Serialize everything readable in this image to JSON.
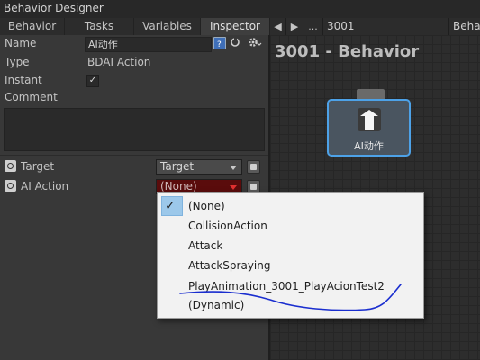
{
  "window": {
    "title": "Behavior Designer"
  },
  "tabs": [
    {
      "label": "Behavior"
    },
    {
      "label": "Tasks"
    },
    {
      "label": "Variables"
    },
    {
      "label": "Inspector"
    }
  ],
  "graph_toolbar": {
    "prev_glyph": "◀",
    "next_glyph": "▶",
    "more_glyph": "...",
    "behavior_id": "3001",
    "behavior_label": "Beha"
  },
  "inspector": {
    "name_label": "Name",
    "name_value": "AI动作",
    "type_label": "Type",
    "type_value": "BDAI Action",
    "instant_label": "Instant",
    "instant_checked": "✓",
    "comment_label": "Comment",
    "comment_value": "",
    "fields": [
      {
        "label": "Target",
        "value": "Target"
      },
      {
        "label": "AI Action",
        "value": "(None)"
      }
    ]
  },
  "graph": {
    "title": "3001 - Behavior",
    "node_label": "AI动作"
  },
  "popup_menu": {
    "check_glyph": "✓",
    "items": [
      {
        "label": "(None)",
        "selected": true
      },
      {
        "label": "CollisionAction"
      },
      {
        "label": "Attack"
      },
      {
        "label": "AttackSpraying"
      },
      {
        "label": "PlayAnimation_3001_PlayAcionTest2"
      },
      {
        "label": "(Dynamic)"
      }
    ]
  },
  "colors": {
    "panel_bg": "#383838",
    "graph_bg": "#2d2d2d",
    "node_border": "#4da2e8",
    "ai_action_field_bg": "#5a0c0c",
    "menu_selection": "#9cc8ea",
    "annotation_ink": "#1a2ecf"
  }
}
